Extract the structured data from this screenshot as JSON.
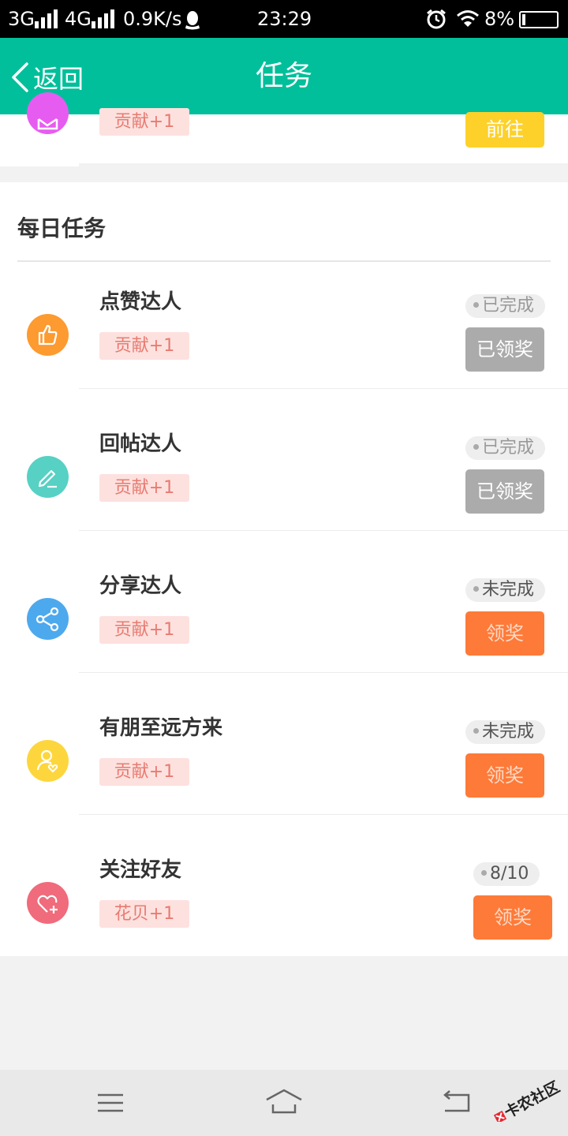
{
  "status_bar": {
    "net_3g": "3G",
    "net_4g": "4G",
    "speed": "0.9K/s",
    "time": "23:29",
    "battery": "8%"
  },
  "header": {
    "back_label": "返回",
    "title": "任务"
  },
  "top_partial": {
    "tag": "贡献+1",
    "button": "前往"
  },
  "daily": {
    "section_title": "每日任务",
    "tasks": [
      {
        "name": "点赞达人",
        "tag": "贡献+1",
        "status": "已完成",
        "button": "已领奖"
      },
      {
        "name": "回帖达人",
        "tag": "贡献+1",
        "status": "已完成",
        "button": "已领奖"
      },
      {
        "name": "分享达人",
        "tag": "贡献+1",
        "status": "未完成",
        "button": "领奖"
      },
      {
        "name": "有朋至远方来",
        "tag": "贡献+1",
        "status": "未完成",
        "button": "领奖"
      },
      {
        "name": "关注好友",
        "tag": "花贝+1",
        "status": "8/10",
        "button": "领奖"
      }
    ]
  },
  "watermark": {
    "text": "卡农社区"
  },
  "colors": {
    "header": "#00bf9a",
    "claimed": "#ababab",
    "claim": "#fe7a38",
    "go": "#fdd12a",
    "tag_bg": "#fde1de",
    "tag_text": "#e87b72"
  },
  "icons": {
    "task_icons": [
      "thumbs-up-icon",
      "pencil-icon",
      "share-icon",
      "friend-icon",
      "heart-plus-icon"
    ],
    "nav": [
      "menu-icon",
      "home-icon",
      "back-icon"
    ]
  }
}
